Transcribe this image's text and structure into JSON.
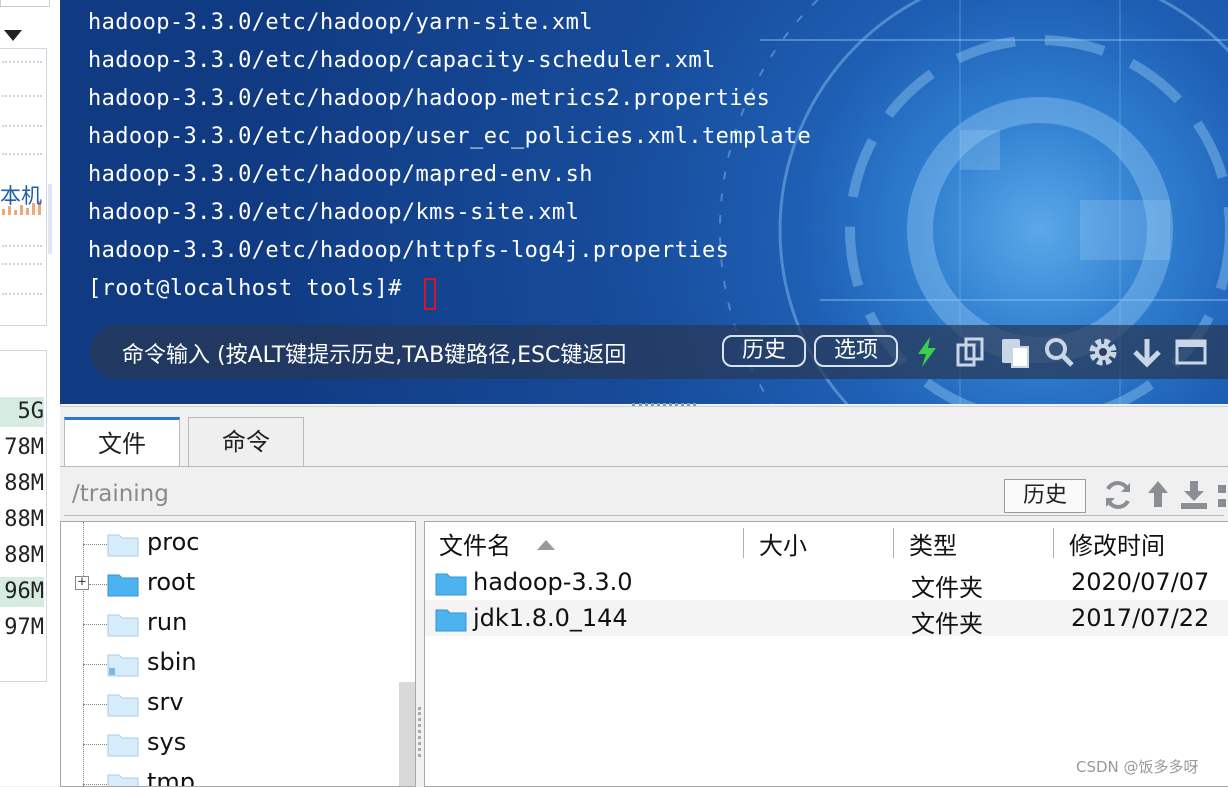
{
  "sidebar": {
    "label": "本机",
    "sizes": [
      "5G",
      "78M",
      "88M",
      "88M",
      "88M",
      "96M",
      "97M"
    ]
  },
  "terminal": {
    "lines": [
      "hadoop-3.3.0/etc/hadoop/yarn-site.xml",
      "hadoop-3.3.0/etc/hadoop/capacity-scheduler.xml",
      "hadoop-3.3.0/etc/hadoop/hadoop-metrics2.properties",
      "hadoop-3.3.0/etc/hadoop/user_ec_policies.xml.template",
      "hadoop-3.3.0/etc/hadoop/mapred-env.sh",
      "hadoop-3.3.0/etc/hadoop/kms-site.xml",
      "hadoop-3.3.0/etc/hadoop/httpfs-log4j.properties"
    ],
    "prompt": "[root@localhost tools]# "
  },
  "command_bar": {
    "hint": "命令输入 (按ALT键提示历史,TAB键路径,ESC键返回",
    "history_label": "历史",
    "options_label": "选项",
    "accent_color": "#3ad14a"
  },
  "file_manager": {
    "tabs": [
      {
        "label": "文件"
      },
      {
        "label": "命令"
      }
    ],
    "path": "/training",
    "history_label": "历史",
    "tree": [
      {
        "name": "proc"
      },
      {
        "name": "root"
      },
      {
        "name": "run"
      },
      {
        "name": "sbin"
      },
      {
        "name": "srv"
      },
      {
        "name": "sys"
      },
      {
        "name": "tmp"
      }
    ],
    "columns": {
      "name": "文件名",
      "size": "大小",
      "type": "类型",
      "modified": "修改时间"
    },
    "files": [
      {
        "name": "hadoop-3.3.0",
        "size": "",
        "type": "文件夹",
        "modified": "2020/07/07"
      },
      {
        "name": "jdk1.8.0_144",
        "size": "",
        "type": "文件夹",
        "modified": "2017/07/22"
      }
    ]
  },
  "watermark": "CSDN @饭多多呀"
}
